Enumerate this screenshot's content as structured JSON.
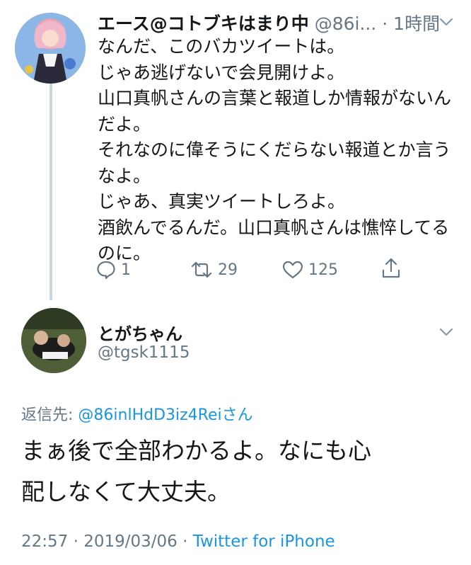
{
  "tweet1": {
    "display_name": "エース@コトブキはまり中",
    "handle": "@86i...",
    "separator": " · ",
    "time": "1時間",
    "text_lines": [
      "なんだ、このバカツイートは。",
      "じゃあ逃げないで会見開けよ。",
      "山口真帆さんの言葉と報道しか情報がないん",
      "だよ。",
      "それなのに偉そうにくだらない報道とか言う",
      "なよ。",
      "じゃあ、真実ツイートしろよ。",
      "酒飲んでるんだ。山口真帆さんは憔悴してる",
      "のに。"
    ],
    "replies": "1",
    "retweets": "29",
    "likes": "125"
  },
  "tweet2": {
    "display_name": "とがちゃん",
    "handle": "@tgsk1115",
    "reply_label": "返信先: ",
    "reply_mention": "@86inlHdD3iz4Reiさん",
    "text_lines": [
      "まぁ後で全部わかるよ。なにも心",
      "配しなくて大丈夫。"
    ],
    "timestamp": "22:57 · 2019/03/06 · ",
    "source": "Twitter for iPhone"
  },
  "colors": {
    "text": "#14171a",
    "secondary": "#657786",
    "link": "#1b95e0",
    "thread_line": "#ccd6dd"
  },
  "icons": [
    "reply-icon",
    "retweet-icon",
    "like-icon",
    "share-icon",
    "chevron-down-icon"
  ]
}
